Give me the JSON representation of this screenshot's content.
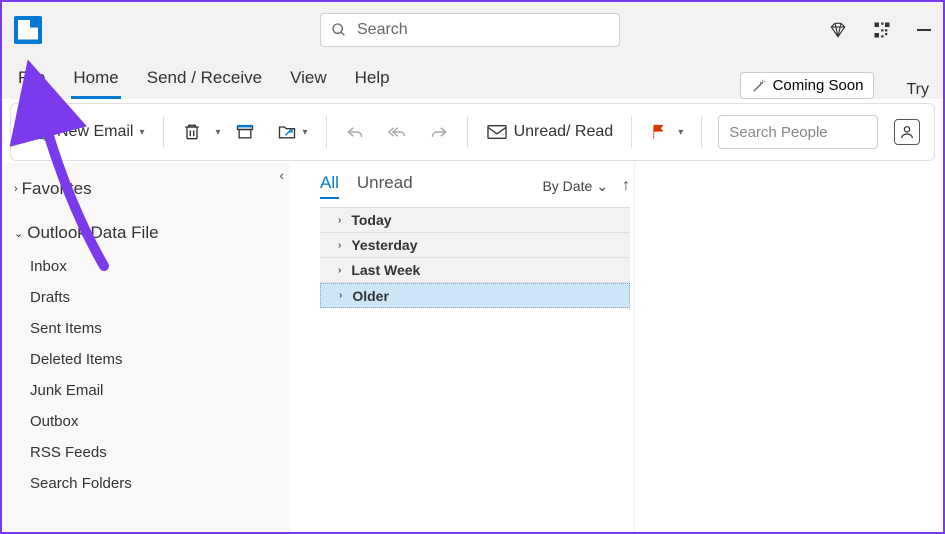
{
  "titlebar": {
    "search_placeholder": "Search",
    "minimize": "—"
  },
  "menu": {
    "tabs": [
      "File",
      "Home",
      "Send / Receive",
      "View",
      "Help"
    ],
    "active": "Home",
    "coming_soon": "Coming Soon",
    "try": "Try"
  },
  "ribbon": {
    "new_email": "New Email",
    "unread_read": "Unread/ Read",
    "search_people_placeholder": "Search People"
  },
  "sidebar": {
    "favorites": "Favorites",
    "data_file": "Outlook Data File",
    "folders": [
      "Inbox",
      "Drafts",
      "Sent Items",
      "Deleted Items",
      "Junk Email",
      "Outbox",
      "RSS Feeds",
      "Search Folders"
    ]
  },
  "msglist": {
    "tabs": {
      "all": "All",
      "unread": "Unread"
    },
    "sort_label": "By Date",
    "groups": [
      "Today",
      "Yesterday",
      "Last Week",
      "Older"
    ],
    "selected_group": "Older"
  },
  "annotation": {
    "target": "File"
  }
}
